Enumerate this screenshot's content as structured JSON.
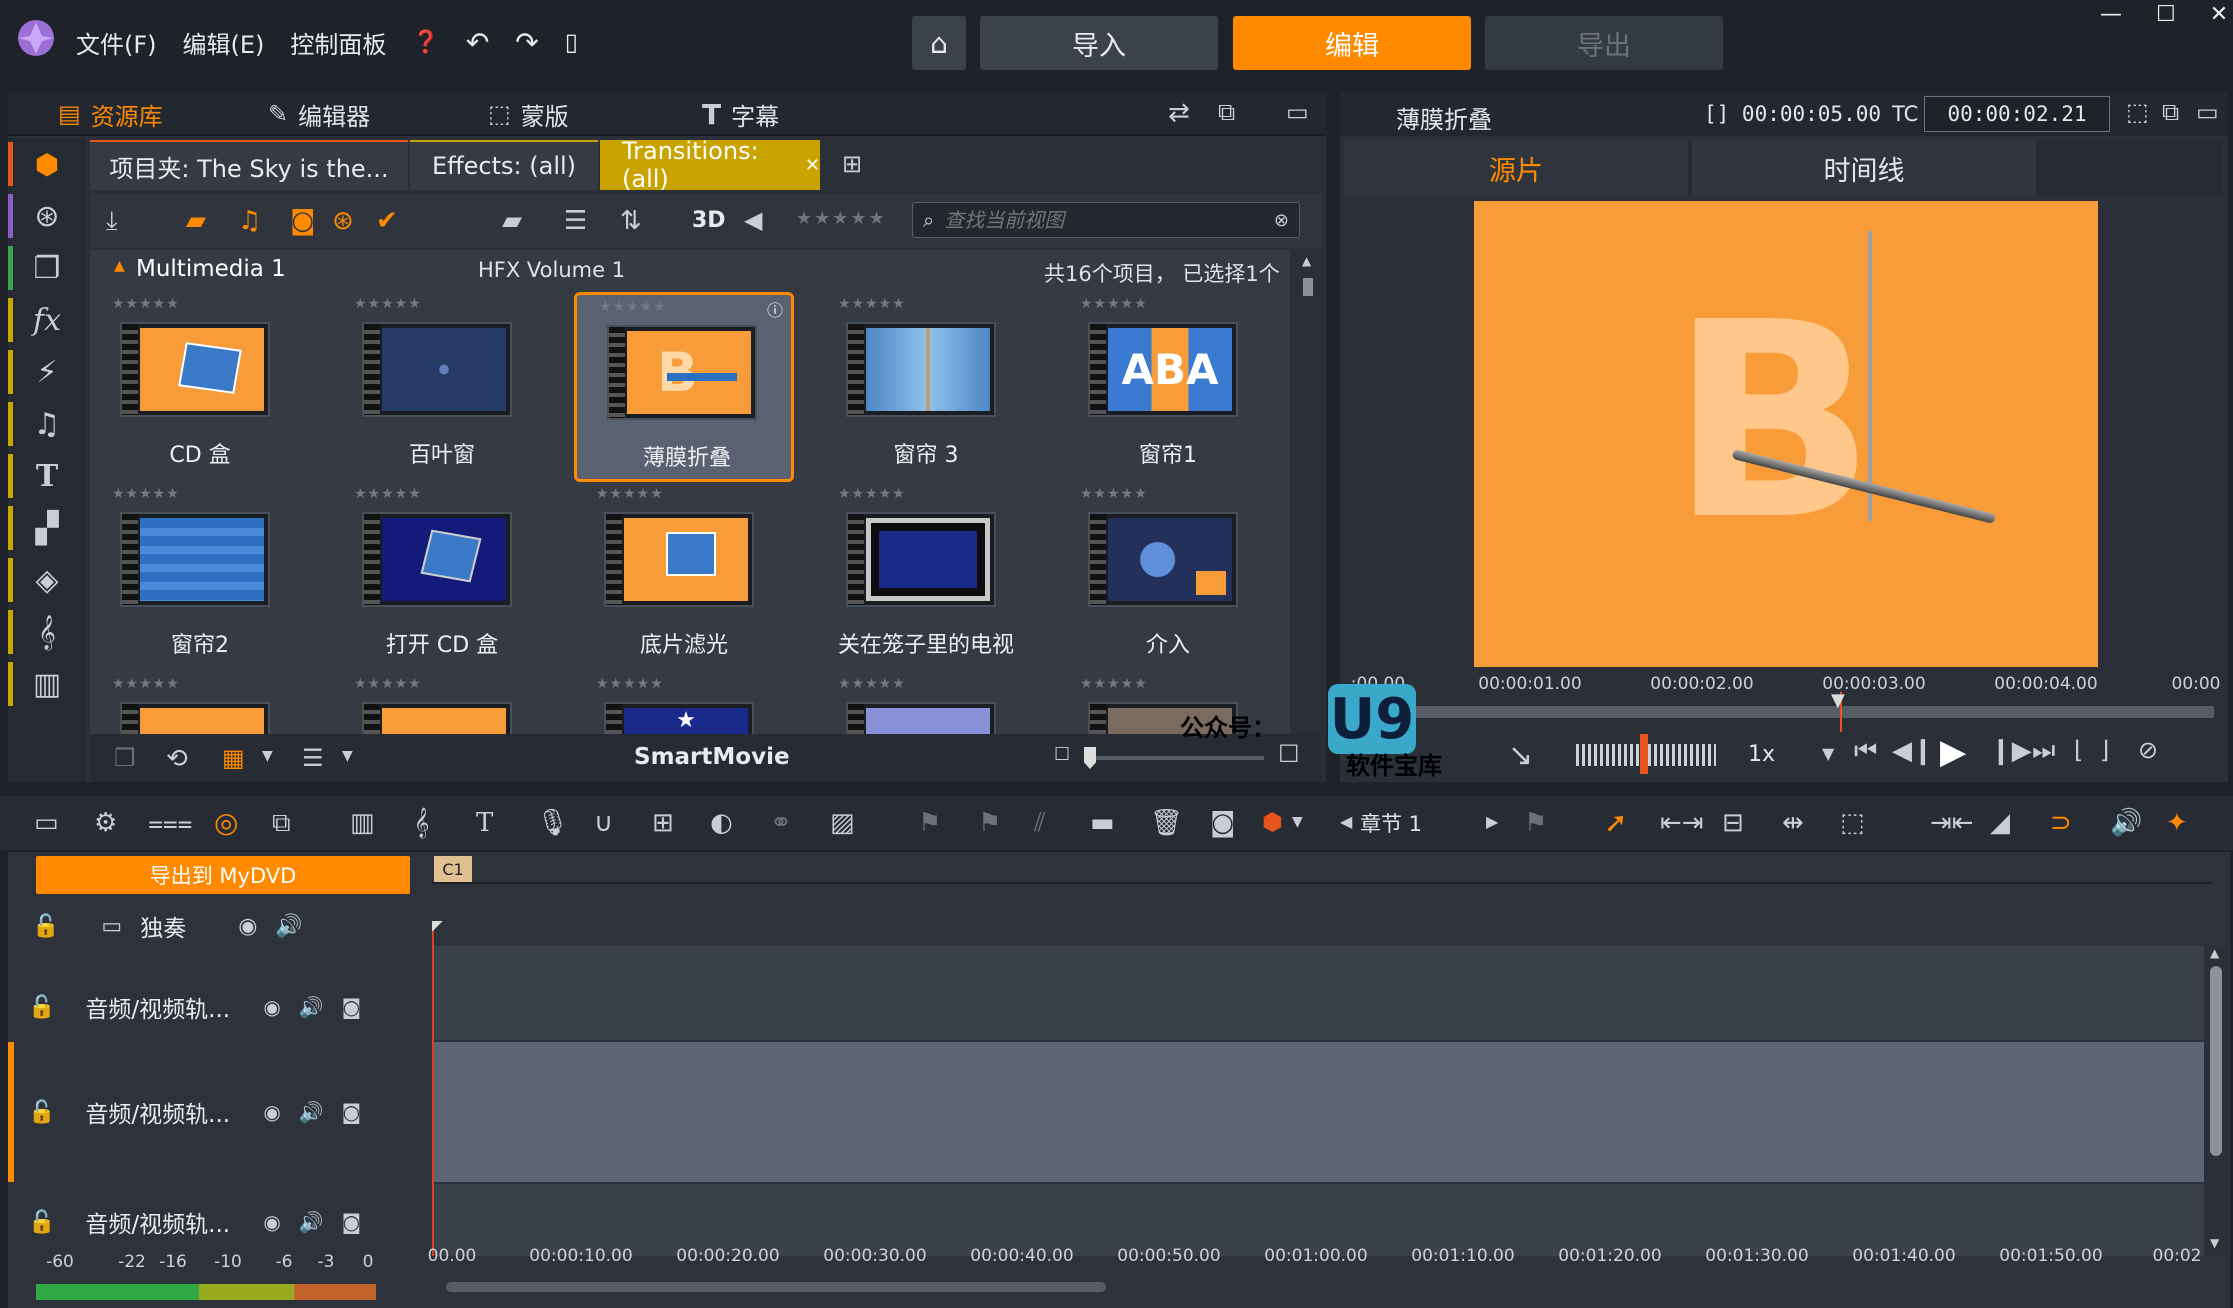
{
  "menu": {
    "file": "文件(F)",
    "edit": "编辑(E)",
    "control_panel": "控制面板"
  },
  "mode_tabs": {
    "import": "导入",
    "edit": "编辑",
    "export": "导出"
  },
  "lib_tabs": {
    "library": "资源库",
    "editor": "编辑器",
    "mask": "蒙版",
    "titles": "字幕"
  },
  "folder_tabs": [
    "项目夹: The Sky is the...",
    "Effects: (all)",
    "Transitions: (all)"
  ],
  "toolbar": {
    "view_3d": "3D",
    "search_placeholder": "查找当前视图"
  },
  "breadcrumb": {
    "collection": "Multimedia 1",
    "volume": "HFX Volume 1",
    "summary": "共16个项目， 已选择1个"
  },
  "tiles": [
    {
      "label": "CD 盒"
    },
    {
      "label": "百叶窗"
    },
    {
      "label": "薄膜折叠"
    },
    {
      "label": "窗帘 3"
    },
    {
      "label": "窗帘1"
    },
    {
      "label": "窗帘2"
    },
    {
      "label": "打开 CD 盒"
    },
    {
      "label": "底片滤光"
    },
    {
      "label": "关在笼子里的电视"
    },
    {
      "label": "介入"
    },
    {
      "label": ""
    },
    {
      "label": ""
    },
    {
      "label": ""
    },
    {
      "label": ""
    },
    {
      "label": ""
    }
  ],
  "lib_bottom": {
    "smartmovie": "SmartMovie"
  },
  "preview": {
    "title": "薄膜折叠",
    "duration": "[] 00:00:05.00",
    "tc_label": "TC",
    "tc_value": "00:00:02.21",
    "tab_source": "源片",
    "tab_timeline": "时间线",
    "ruler": [
      ":00.00",
      "00:00:01.00",
      "00:00:02.00",
      "00:00:03.00",
      "00:00:04.00",
      "00:00"
    ],
    "speed": "1x"
  },
  "timeline": {
    "chapter": "章节 1",
    "export_button": "导出到 MyDVD",
    "marker": "C1",
    "solo": "独奏",
    "tracks": [
      {
        "name": "音频/视频轨..."
      },
      {
        "name": "音频/视频轨..."
      },
      {
        "name": "音频/视频轨..."
      }
    ],
    "ruler": [
      "00.00",
      "00:00:10.00",
      "00:00:20.00",
      "00:00:30.00",
      "00:00:40.00",
      "00:00:50.00",
      "00:01:00.00",
      "00:01:10.00",
      "00:01:20.00",
      "00:01:30.00",
      "00:01:40.00",
      "00:01:50.00",
      "00:02"
    ],
    "meter_scale": [
      "-60",
      "-22",
      "-16",
      "-10",
      "-6",
      "-3",
      "0"
    ]
  },
  "watermark": {
    "line1": "公众号：",
    "logo": "U9",
    "line2": "软件宝库"
  },
  "colors": {
    "accent": "#ff8a00",
    "tab_active": "#c9a400",
    "panel": "#2b3038"
  }
}
